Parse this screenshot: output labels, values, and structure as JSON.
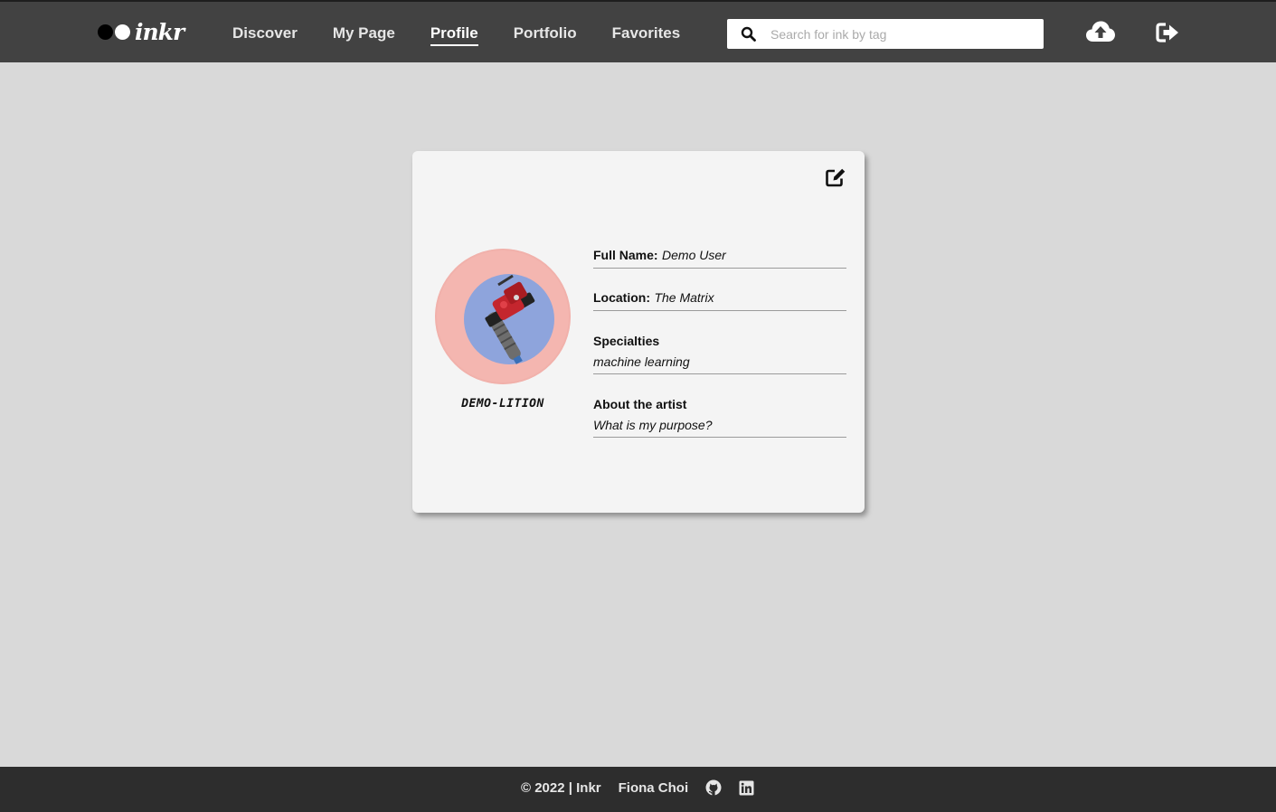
{
  "app": {
    "logo_text": "inkr"
  },
  "nav": {
    "items": [
      {
        "label": "Discover"
      },
      {
        "label": "My Page"
      },
      {
        "label": "Profile"
      },
      {
        "label": "Portfolio"
      },
      {
        "label": "Favorites"
      }
    ],
    "active": "Profile"
  },
  "search": {
    "placeholder": "Search for ink by tag",
    "value": ""
  },
  "header_icons": [
    "upload-cloud-icon",
    "logout-icon"
  ],
  "profile": {
    "username": "DEMO-LITION",
    "full_name_label": "Full Name:",
    "full_name": "Demo User",
    "location_label": "Location:",
    "location": "The Matrix",
    "specialties_label": "Specialties",
    "specialties": "machine learning",
    "about_label": "About the artist",
    "about": "What is my purpose?"
  },
  "footer": {
    "copyright": "© 2022 | Inkr",
    "author": "Fiona Choi",
    "icons": [
      "github-icon",
      "linkedin-icon"
    ]
  },
  "colors": {
    "header_bg": "#424242",
    "page_bg": "#d9d9d9",
    "card_bg": "#f4f4f4",
    "footer_bg": "#2d2d2d",
    "avatar_ring": "#f4b6b0",
    "avatar_inner": "#8ea4dc"
  }
}
